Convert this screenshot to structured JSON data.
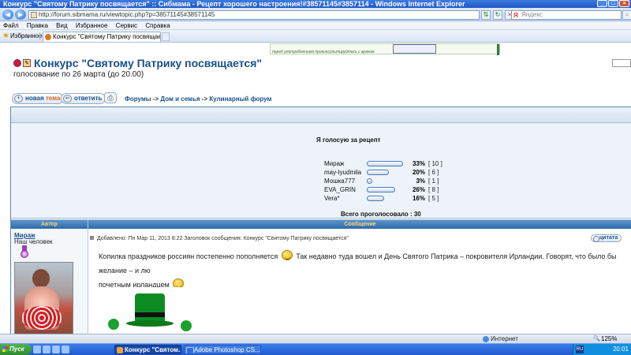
{
  "window": {
    "title": "Конкурс \"Святому Патрику посвящается\" :: Сибмама - Рецепт хорошего настроения!#38571145#3857114 - Windows Internet Explorer",
    "controls": [
      "_",
      "□",
      "×"
    ]
  },
  "address_bar": {
    "url": "http://forum.sibmama.ru/viewtopic.php?p=38571145#38571145",
    "search_placeholder": "Яндекс"
  },
  "menu": [
    "Файл",
    "Правка",
    "Вид",
    "Избранное",
    "Сервис",
    "Справка"
  ],
  "favorites": {
    "label": "Избранное",
    "tab_title": "Конкурс \"Святому Патрику посвящается\" :..."
  },
  "banner": {
    "text": "перед употреблением проконсультируйтесь с врачом"
  },
  "topic": {
    "title": "Конкурс \"Святому Патрику посвящается\"",
    "subtitle": "голосование по 26 марта (до 20.00)"
  },
  "buttons": {
    "new_topic_main": "новая",
    "new_topic_accent": "тема",
    "reply": "ответить",
    "quote": "цитата"
  },
  "breadcrumbs": {
    "items": [
      "Форумы",
      "Дом и семья",
      "Кулинарный форум"
    ],
    "separator": "->"
  },
  "poll": {
    "question": "Я голосую за рецепт",
    "options": [
      {
        "name": "Мираж",
        "percent": "33%",
        "votes": "[ 10 ]",
        "fraction": 0.33
      },
      {
        "name": "may-lyudmila",
        "percent": "20%",
        "votes": "[ 6 ]",
        "fraction": 0.2
      },
      {
        "name": "Мошка777",
        "percent": "3%",
        "votes": "[ 1 ]",
        "fraction": 0.03
      },
      {
        "name": "EVA_GRIN",
        "percent": "26%",
        "votes": "[ 8 ]",
        "fraction": 0.26
      },
      {
        "name": "Vera*",
        "percent": "16%",
        "votes": "[ 5 ]",
        "fraction": 0.16
      }
    ],
    "total": "Всего проголосовало : 30"
  },
  "post_table": {
    "col_author": "Автор",
    "col_message": "Сообщение"
  },
  "post": {
    "author": "Мираж",
    "rank": "Наш человек",
    "meta": "Добавлено: Пн Мар 11, 2013 8:22    Заголовок сообщения: Конкурс \"Святому Патрику посвящается\"",
    "text_part1": "Копилка праздников россиян постепенно пополняется",
    "text_part2": "Так недавно туда вошел и День Святого Патрика – покровителя Ирландии. Говорят, что было бы желание – и лю",
    "text_part3": "почетным ирландцем"
  },
  "statusbar": {
    "zone": "Интернет",
    "zoom": "125%"
  },
  "taskbar": {
    "start": "Пуск",
    "tasks": [
      "Конкурс \"Святом...",
      "Adobe Photoshop CS..."
    ],
    "lang": "RU",
    "clock": "20:01"
  },
  "colors": {
    "accent_blue": "#1b4f8a",
    "header_blue": "#2e6aa8",
    "poll_bg": "#edf3f8"
  }
}
